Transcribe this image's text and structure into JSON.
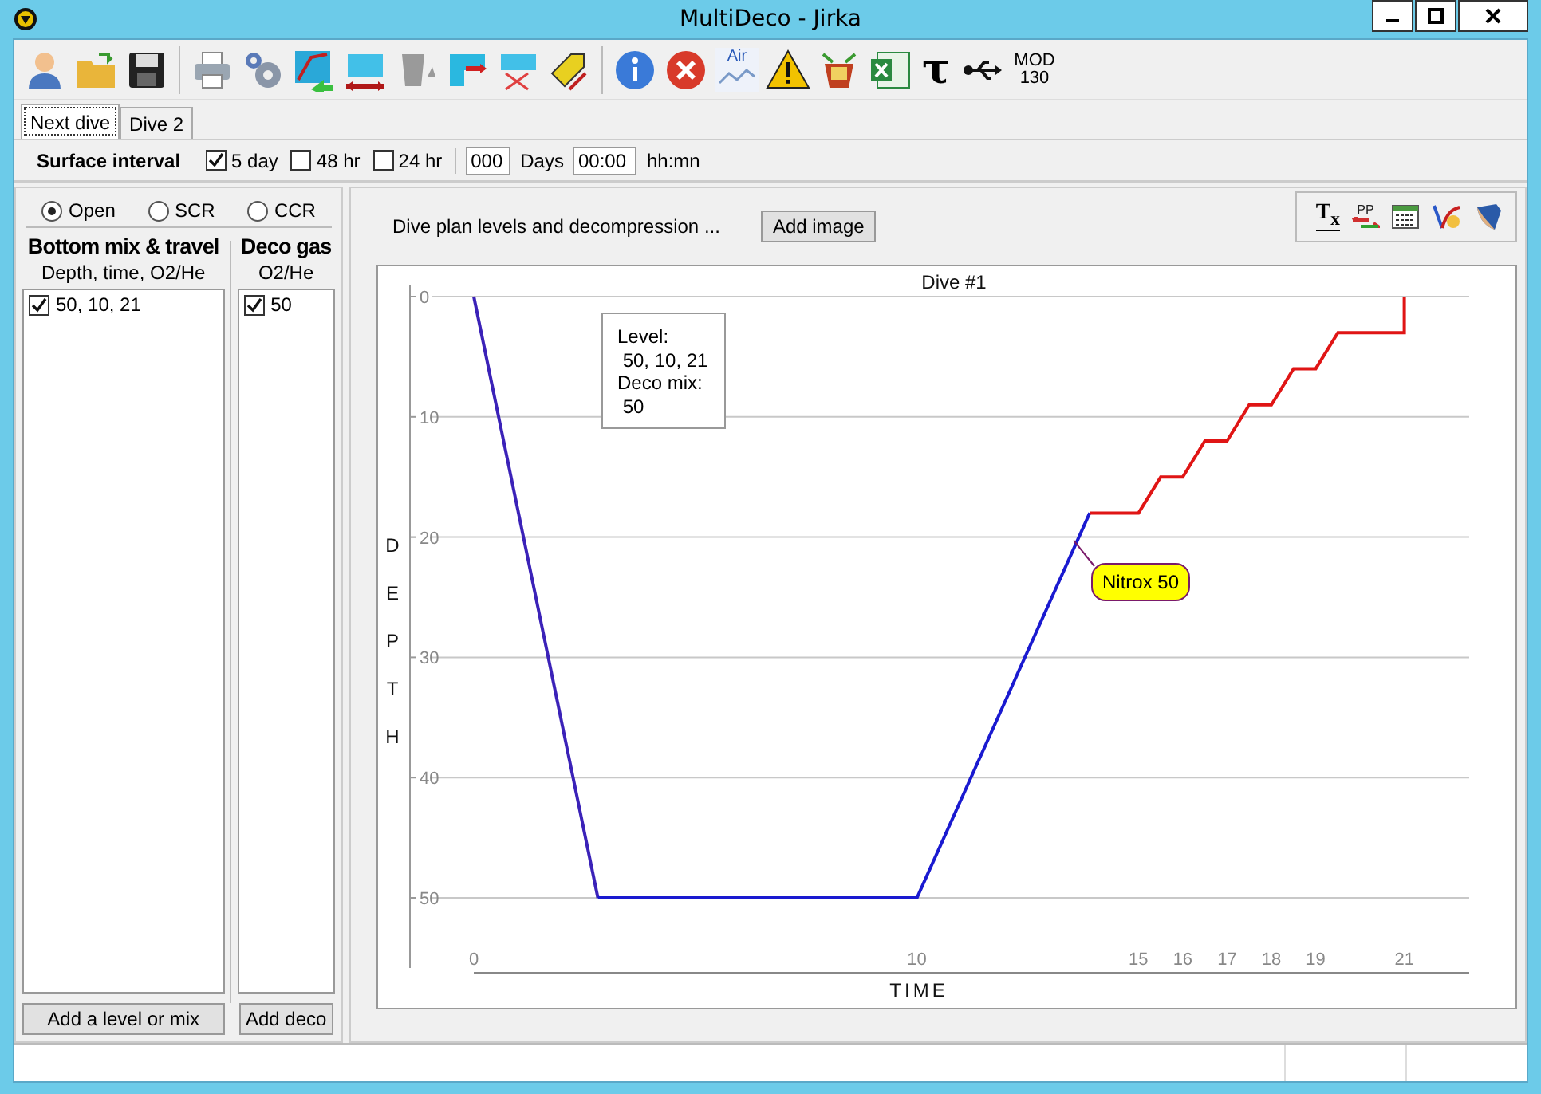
{
  "window": {
    "title": "MultiDeco - Jirka"
  },
  "toolbar": [
    {
      "kind": "person"
    },
    {
      "kind": "folder"
    },
    {
      "kind": "save"
    },
    {
      "kind": "sep"
    },
    {
      "kind": "printer"
    },
    {
      "kind": "gears"
    },
    {
      "kind": "route"
    },
    {
      "kind": "pool-arrows"
    },
    {
      "kind": "bucket"
    },
    {
      "kind": "pool-flag"
    },
    {
      "kind": "pool-cross"
    },
    {
      "kind": "tag"
    },
    {
      "kind": "sep"
    },
    {
      "kind": "info"
    },
    {
      "kind": "cancel"
    },
    {
      "kind": "air",
      "label": "Air"
    },
    {
      "kind": "warning"
    },
    {
      "kind": "basket"
    },
    {
      "kind": "sheet"
    },
    {
      "kind": "glyph",
      "label": "τ"
    },
    {
      "kind": "usb"
    },
    {
      "kind": "text",
      "label": "MOD 130"
    }
  ],
  "tabs": [
    {
      "label": "Next dive",
      "selected": true
    },
    {
      "label": "Dive 2",
      "selected": false
    }
  ],
  "surface_interval": {
    "label": "Surface interval",
    "options": [
      {
        "label": "5 day",
        "checked": true
      },
      {
        "label": "48 hr",
        "checked": false
      },
      {
        "label": "24 hr",
        "checked": false
      }
    ],
    "days": {
      "value": "000",
      "unit": "Days"
    },
    "time": {
      "value": "00:00",
      "unit": "hh:mn"
    }
  },
  "circuit": [
    {
      "label": "Open",
      "selected": true
    },
    {
      "label": "SCR",
      "selected": false
    },
    {
      "label": "CCR",
      "selected": false
    }
  ],
  "bottom_mix": {
    "title": "Bottom mix & travel",
    "subtitle": "Depth, time, O2/He",
    "items": [
      {
        "label": "50, 10, 21",
        "checked": true
      }
    ],
    "button": "Add a level or mix"
  },
  "deco_gas": {
    "title": "Deco gas",
    "subtitle": "O2/He",
    "items": [
      {
        "label": "50",
        "checked": true
      }
    ],
    "button": "Add deco"
  },
  "plan": {
    "caption": "Dive plan levels and decompression ...",
    "button": "Add image",
    "tools": [
      {
        "kind": "text",
        "label": "T$_{x}$"
      },
      {
        "kind": "pp",
        "label": "PP"
      },
      {
        "kind": "table"
      },
      {
        "kind": "curve"
      },
      {
        "kind": "shield"
      }
    ],
    "chart_data": {
      "type": "line",
      "title": "Dive #1",
      "xlabel": "TIME",
      "ylabel": "DEPTH",
      "x": [
        0,
        2.8,
        10,
        13.9,
        15,
        15.5,
        16,
        16.5,
        17,
        17.5,
        18,
        18.5,
        19,
        19.5,
        21,
        21
      ],
      "series": [
        {
          "color": "#3b22b8",
          "values": [
            0,
            50,
            null,
            null,
            null,
            null,
            null,
            null,
            null,
            null,
            null,
            null,
            null,
            null,
            null,
            null
          ]
        },
        {
          "color": "#1a1ad0",
          "values": [
            null,
            50,
            50,
            18,
            null,
            null,
            null,
            null,
            null,
            null,
            null,
            null,
            null,
            null,
            null,
            null
          ]
        },
        {
          "color": "#e01515",
          "values": [
            null,
            null,
            null,
            18,
            18,
            15,
            15,
            12,
            12,
            9,
            9,
            6,
            6,
            3,
            3,
            0
          ]
        }
      ],
      "xlim": [
        0,
        22.5
      ],
      "ylim": [
        50,
        0
      ],
      "xticks": [
        0,
        10,
        15,
        16,
        17,
        18,
        19,
        21
      ],
      "yticks": [
        0,
        10,
        20,
        30,
        40,
        50
      ],
      "grid": true,
      "annotations": [
        {
          "text": "Nitrox 50",
          "x": 13.5,
          "y": 20
        }
      ]
    },
    "tooltip": {
      "lines": [
        "Level:",
        " 50, 10, 21",
        "Deco mix:",
        " 50"
      ]
    }
  }
}
